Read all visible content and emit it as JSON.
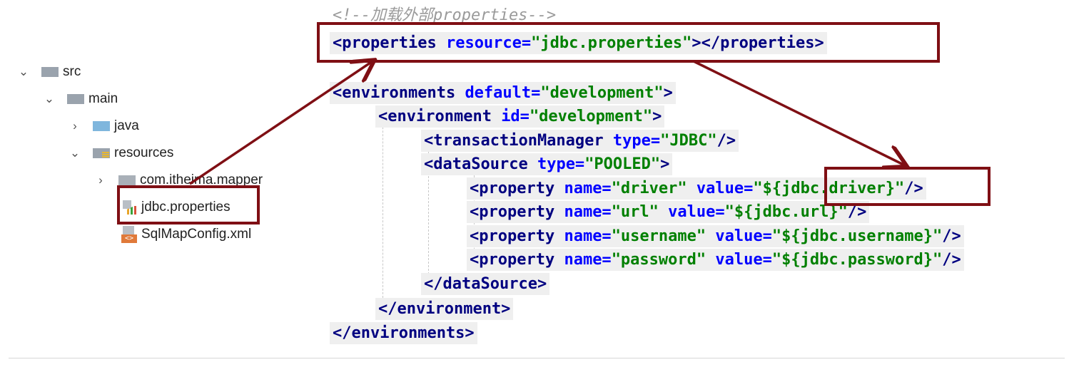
{
  "file_tree": {
    "items": [
      {
        "label": "src",
        "expanded": true,
        "icon": "folder-icon"
      },
      {
        "label": "main",
        "expanded": true,
        "icon": "folder-icon"
      },
      {
        "label": "java",
        "expanded": false,
        "icon": "source-folder-icon"
      },
      {
        "label": "resources",
        "expanded": true,
        "icon": "resources-folder-icon"
      },
      {
        "label": "com.itheima.mapper",
        "expanded": false,
        "icon": "package-icon"
      },
      {
        "label": "jdbc.properties",
        "icon": "properties-file-icon"
      },
      {
        "label": "SqlMapConfig.xml",
        "icon": "xml-file-icon"
      }
    ]
  },
  "code": {
    "comment": "<!--加载外部properties-->",
    "properties_line": {
      "open": "<properties ",
      "attr": "resource=",
      "value": "\"jdbc.properties\"",
      "close": "></properties>"
    },
    "env_open": {
      "tag": "<environments ",
      "attr": "default=",
      "value": "\"development\"",
      "end": ">"
    },
    "environment_open": {
      "tag": "<environment ",
      "attr": "id=",
      "value": "\"development\"",
      "end": ">"
    },
    "transaction": {
      "tag": "<transactionManager ",
      "attr": "type=",
      "value": "\"JDBC\"",
      "end": "/>"
    },
    "datasource_open": {
      "tag": "<dataSource ",
      "attr": "type=",
      "value": "\"POOLED\"",
      "end": ">"
    },
    "properties": [
      {
        "tag": "<property ",
        "name_attr": "name=",
        "name": "\"driver\"",
        "value_attr": " value=",
        "value": "\"${jdbc.driver}\"",
        "end": "/>"
      },
      {
        "tag": "<property ",
        "name_attr": "name=",
        "name": "\"url\"",
        "value_attr": " value=",
        "value": "\"${jdbc.url}\"",
        "end": "/>"
      },
      {
        "tag": "<property ",
        "name_attr": "name=",
        "name": "\"username\"",
        "value_attr": " value=",
        "value": "\"${jdbc.username}\"",
        "end": "/>"
      },
      {
        "tag": "<property ",
        "name_attr": "name=",
        "name": "\"password\"",
        "value_attr": " value=",
        "value": "\"${jdbc.password}\"",
        "end": "/>"
      }
    ],
    "datasource_close": "</dataSource>",
    "environment_close": "</environment>",
    "env_close": "</environments>"
  },
  "colors": {
    "tag": "#000080",
    "attribute": "#0000ff",
    "value": "#008000",
    "highlight": "#7f0f14"
  }
}
